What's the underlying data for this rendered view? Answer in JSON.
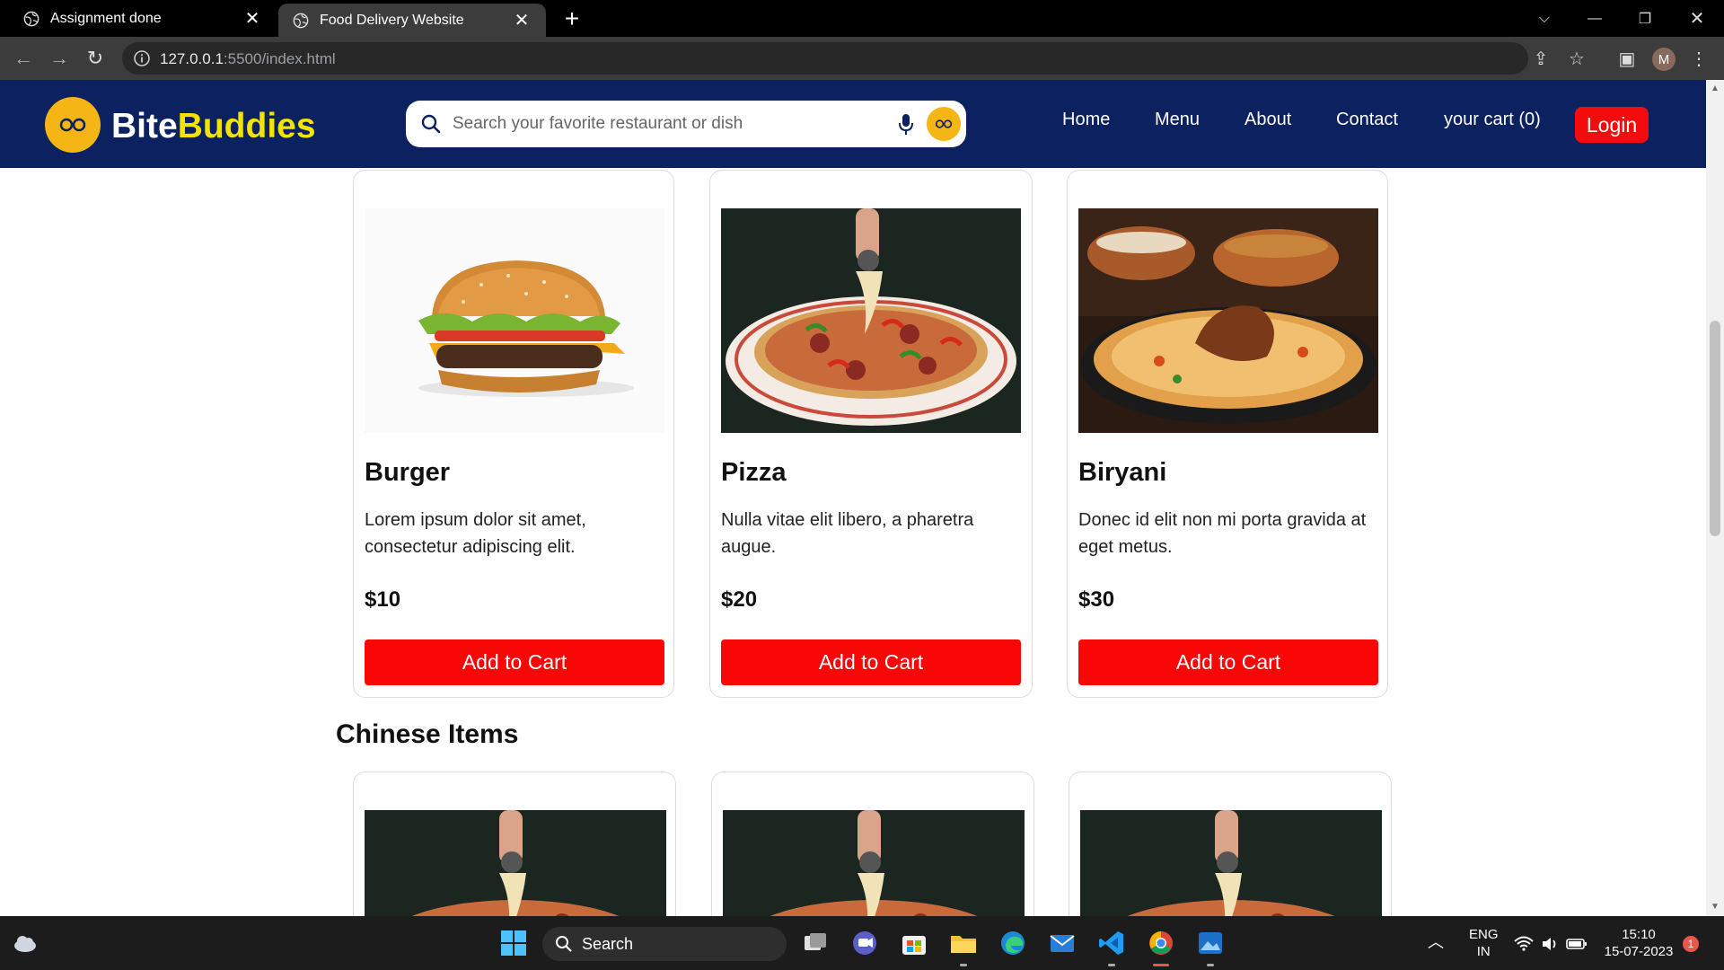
{
  "browser": {
    "tabs": [
      {
        "title": "Assignment done",
        "active": false
      },
      {
        "title": "Food Delivery Website",
        "active": true
      }
    ],
    "url_host": "127.0.0.1",
    "url_rest": ":5500/index.html",
    "profile_initial": "M"
  },
  "site": {
    "brand_part1": "Bite",
    "brand_part2": "Buddies",
    "search_placeholder": "Search your favorite restaurant or dish",
    "nav": [
      "Home",
      "Menu",
      "About",
      "Contact",
      "your cart (0)"
    ],
    "login_label": "Login",
    "colors": {
      "header": "#0c2160",
      "accent": "#f5b514",
      "brand_yellow": "#f2e400",
      "button_red": "#f90606"
    }
  },
  "items": [
    {
      "name": "Burger",
      "description": "Lorem ipsum dolor sit amet, consectetur adipiscing elit.",
      "price": "$10",
      "button": "Add to Cart",
      "image": "burger-image"
    },
    {
      "name": "Pizza",
      "description": "Nulla vitae elit libero, a pharetra augue.",
      "price": "$20",
      "button": "Add to Cart",
      "image": "pizza-image"
    },
    {
      "name": "Biryani",
      "description": "Donec id elit non mi porta gravida at eget metus.",
      "price": "$30",
      "button": "Add to Cart",
      "image": "biryani-image"
    }
  ],
  "chinese_section_title": "Chinese Items",
  "taskbar": {
    "search_label": "Search",
    "lang_line1": "ENG",
    "lang_line2": "IN",
    "time": "15:10",
    "date": "15-07-2023",
    "notification_count": "1"
  }
}
